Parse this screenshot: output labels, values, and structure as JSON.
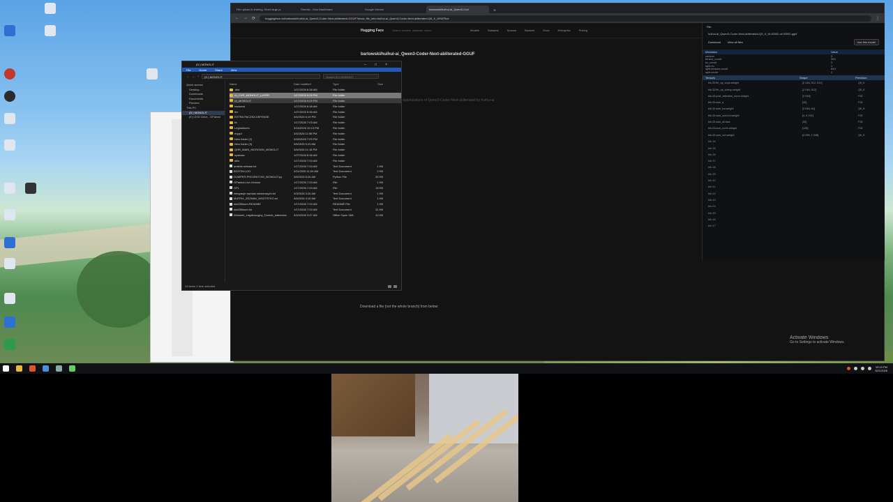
{
  "desktop": {
    "icons": [
      {
        "label": "",
        "color": "#dfe6ef"
      },
      {
        "label": "",
        "color": "#2f6fd1"
      },
      {
        "label": "",
        "color": "#c0392b"
      },
      {
        "label": "",
        "color": "#2b2b2b"
      },
      {
        "label": "",
        "color": "#dfe6ef"
      }
    ]
  },
  "browser": {
    "tabs": [
      {
        "label": "File upload & sharing. Send large pr"
      },
      {
        "label": "Stremio - Kick Dashboard"
      },
      {
        "label": "Google Gemini"
      },
      {
        "label": "bartowski/huihui-ai_Qwen3-Cod"
      }
    ],
    "url": "huggingface.co/bartowski/huihui-ai_Qwen3-Coder-Next-abliterated-GGUF?show_file_info=huihui-ai_Qwen3-Coder-Next-abliterated-Q5_K_M%2Fhui",
    "site": {
      "logo": "Hugging Face",
      "search_placeholder": "Search models, datasets, users...",
      "nav": [
        "Models",
        "Datasets",
        "Spaces",
        "Buckets",
        "Docs",
        "Enterprise",
        "Pricing"
      ],
      "repo_title": "bartowski/huihui-ai_Qwen3-Coder-Next-abliterated-GGUF",
      "desc_line": "quantizations of Qwen3-Coder-Next-abliterated by huihui-ai",
      "download_hint": "Download a file (not the whole branch) from below:"
    },
    "panel": {
      "header": "File",
      "filename": "huihui-ai_Qwen3-Coder-Next-abliterated-Q5_K_M-00002-of-00002.gguf",
      "download_label": "Download",
      "view_files_label": "View all files",
      "use_model_label": "Use this model",
      "metadata_header": "Metadata",
      "value_header": "Value",
      "metadata": [
        {
          "k": "version",
          "v": "3"
        },
        {
          "k": "tensor_count",
          "v": "354"
        },
        {
          "k": "kv_count",
          "v": "3"
        },
        {
          "k": "split.no",
          "v": "1"
        },
        {
          "k": "split.tensors.count",
          "v": "843"
        },
        {
          "k": "split.count",
          "v": "2"
        }
      ],
      "tensors_header": "Tensors",
      "shape_header": "Shape",
      "precision_header": "Precision",
      "tensors": [
        {
          "name": "blk.33.ffn_up_exps.weight",
          "shape": "[2 048, 512, 512]",
          "prec": "Q5_K"
        },
        {
          "name": "blk.33.ffn_up_shexp.weight",
          "shape": "[2 048, 512]",
          "prec": "Q5_K"
        },
        {
          "name": "blk.33.post_attention_norm.weight",
          "shape": "[2 048]",
          "prec": "F32"
        },
        {
          "name": "blk.33.ssm_a",
          "shape": "[32]",
          "prec": "F32"
        },
        {
          "name": "blk.33.ssm_ba.weight",
          "shape": "[2 048, 64]",
          "prec": "Q5_K"
        },
        {
          "name": "blk.33.ssm_conv1d.weight",
          "shape": "[4, 8 192]",
          "prec": "F32"
        },
        {
          "name": "blk.33.ssm_dt.bias",
          "shape": "[32]",
          "prec": "F32"
        },
        {
          "name": "blk.33.ssm_norm.weight",
          "shape": "[128]",
          "prec": "F32"
        },
        {
          "name": "blk.33.ssm_out.weight",
          "shape": "[4 096, 2 048]",
          "prec": "Q5_K"
        }
      ],
      "blocks": [
        "blk.34",
        "blk.35",
        "blk.36",
        "blk.37",
        "blk.38",
        "blk.39",
        "blk.40",
        "blk.41",
        "blk.42",
        "blk.43",
        "blk.44",
        "blk.45",
        "blk.46",
        "blk.47"
      ]
    }
  },
  "explorer": {
    "title": "(D:) MONOLIT",
    "ribbon": [
      "File",
      "Home",
      "Share",
      "View"
    ],
    "path": "(D:) MONOLIT",
    "search_placeholder": "Search (D:) MONOLIT",
    "nav": [
      "Quick access",
      "Desktop",
      "Downloads",
      "Documents",
      "Pictures",
      "This PC",
      "(D:) MONOLIT",
      "(E:) DVD Drive - GParted"
    ],
    "columns": {
      "name": "Name",
      "date": "Date modified",
      "type": "Type",
      "size": "Size"
    },
    "files": [
      {
        "name": ".dist",
        "date": "1/27/2026 8:38 AM",
        "type": "File folder",
        "size": "",
        "kind": "folder"
      },
      {
        "name": "AI_CVR_MONOLIT_LAYER",
        "date": "1/17/2026 9:29 PM",
        "type": "File folder",
        "size": "",
        "kind": "folder"
      },
      {
        "name": "AI_MONOLIT",
        "date": "1/17/2026 9:29 PM",
        "type": "File folder",
        "size": "",
        "kind": "folder"
      },
      {
        "name": "backend",
        "date": "1/27/2026 8:38 AM",
        "type": "File folder",
        "size": "",
        "kind": "folder"
      },
      {
        "name": "bin",
        "date": "1/27/2026 8:38 AM",
        "type": "File folder",
        "size": "",
        "kind": "folder"
      },
      {
        "name": "EXTRA PACZKA DEFENSE",
        "date": "3/4/2026 6:19 PM",
        "type": "File folder",
        "size": "",
        "kind": "folder"
      },
      {
        "name": "fix",
        "date": "1/17/2026 7:03 AM",
        "type": "File folder",
        "size": "",
        "kind": "folder"
      },
      {
        "name": "Legislatures",
        "date": "3/16/2026 10:13 PM",
        "type": "File folder",
        "size": "",
        "kind": "folder"
      },
      {
        "name": "mygui",
        "date": "3/4/2026 11:56 PM",
        "type": "File folder",
        "size": "",
        "kind": "folder"
      },
      {
        "name": "New folder (2)",
        "date": "3/18/2026 7:03 PM",
        "type": "File folder",
        "size": "",
        "kind": "folder"
      },
      {
        "name": "New folder (3)",
        "date": "3/6/2026 5:20 AM",
        "type": "File folder",
        "size": "",
        "kind": "folder"
      },
      {
        "name": "QHR_MAIN_INCROWN_MONOLIT",
        "date": "3/8/2026 11:16 PM",
        "type": "File folder",
        "size": "",
        "kind": "folder"
      },
      {
        "name": "sysbase",
        "date": "1/27/2026 8:38 AM",
        "type": "File folder",
        "size": "",
        "kind": "folder"
      },
      {
        "name": "utils",
        "date": "1/17/2026 7:03 AM",
        "type": "File folder",
        "size": "",
        "kind": "folder"
      },
      {
        "name": "ansible-release.txt",
        "date": "1/17/2026 7:03 AM",
        "type": "Text Document",
        "size": "1 KB",
        "kind": "file"
      },
      {
        "name": "BOOTM.LOG",
        "date": "3/11/2026 11:00 AM",
        "type": "Text Document",
        "size": "2 KB",
        "kind": "file"
      },
      {
        "name": "DUMPER-PROJEKTOW_MONOLIT.py",
        "date": "3/8/2026 6:26 AM",
        "type": "Python File",
        "size": "26 KB",
        "kind": "file"
      },
      {
        "name": "GParted-Live-Version",
        "date": "1/17/2026 7:03 AM",
        "type": "File",
        "size": "1 KB",
        "kind": "file"
      },
      {
        "name": "GPL",
        "date": "1/17/2026 7:03 AM",
        "type": "File",
        "size": "18 KB",
        "kind": "file"
      },
      {
        "name": "integracje wymian wiedzowych.txt",
        "date": "3/3/2026 3:26 AM",
        "type": "Text Document",
        "size": "1 KB",
        "kind": "file"
      },
      {
        "name": "MATRIX_ZEZNAN_WSZYSTKO.txt",
        "date": "3/6/2026 4:19 AM",
        "type": "Text Document",
        "size": "1 KB",
        "kind": "file"
      },
      {
        "name": "sha256sum.README",
        "date": "1/17/2026 7:03 AM",
        "type": "README File",
        "size": "1 KB",
        "kind": "file"
      },
      {
        "name": "sha256sum.txt",
        "date": "1/17/2026 7:03 AM",
        "type": "Text Document",
        "size": "31 KB",
        "kind": "file"
      },
      {
        "name": "Wniosek_Legalizacyjny_Domek_kalendarz",
        "date": "3/10/2026 3:47 AM",
        "type": "Office Open XML",
        "size": "10 KB",
        "kind": "file"
      }
    ],
    "status": "24 items   1 item selected"
  },
  "watermark": {
    "title": "Activate Windows",
    "subtitle": "Go to Settings to activate Windows."
  },
  "taskbar": {
    "icons": [
      {
        "name": "start",
        "color": "#ffffff"
      },
      {
        "name": "explorer",
        "color": "#e8b93e"
      },
      {
        "name": "brave",
        "color": "#e0542e"
      },
      {
        "name": "chrome",
        "color": "#4a90d9"
      },
      {
        "name": "app",
        "color": "#8aa"
      },
      {
        "name": "app2",
        "color": "#6c6"
      }
    ],
    "time": "10:13 PM",
    "date": "3/21/2026"
  }
}
